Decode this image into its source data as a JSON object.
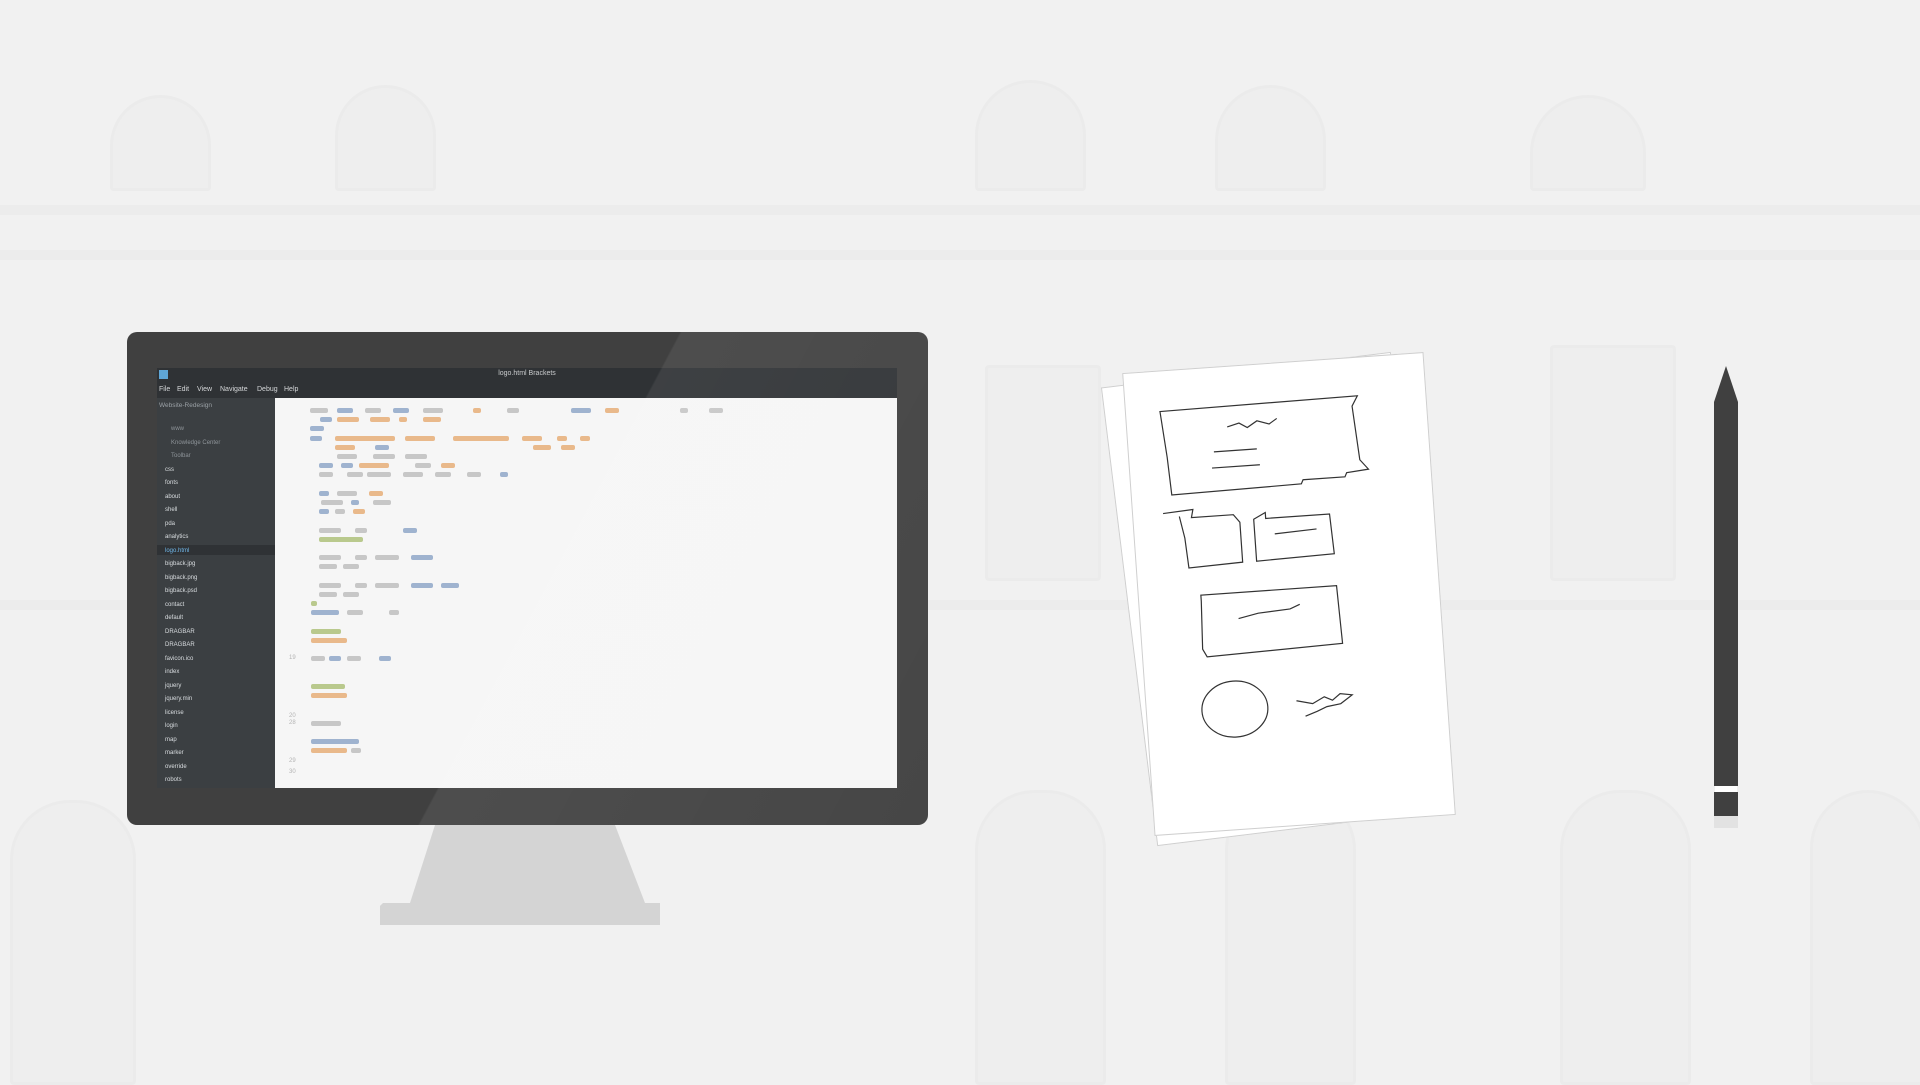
{
  "editor": {
    "window_title": "logo.html  Brackets",
    "menu": [
      "File",
      "Edit",
      "View",
      "Navigate",
      "Debug",
      "Help"
    ],
    "sidebar_header": "Website-Redesign",
    "files": [
      {
        "name": "www",
        "state": "muted"
      },
      {
        "name": "Knowledge Center",
        "state": "muted"
      },
      {
        "name": "Toolbar",
        "state": "muted"
      },
      {
        "name": "css",
        "state": "normal"
      },
      {
        "name": "fonts",
        "state": "normal"
      },
      {
        "name": "about",
        "state": "normal"
      },
      {
        "name": "shell",
        "state": "normal"
      },
      {
        "name": "pda",
        "state": "normal"
      },
      {
        "name": "analytics",
        "state": "normal"
      },
      {
        "name": "logo.html",
        "state": "active"
      },
      {
        "name": "bigback.jpg",
        "state": "normal"
      },
      {
        "name": "bigback.png",
        "state": "normal"
      },
      {
        "name": "bigback.psd",
        "state": "normal"
      },
      {
        "name": "contact",
        "state": "normal"
      },
      {
        "name": "default",
        "state": "normal"
      },
      {
        "name": "DRAGBAR",
        "state": "normal"
      },
      {
        "name": "DRAGBAR",
        "state": "normal"
      },
      {
        "name": "favicon.ico",
        "state": "normal"
      },
      {
        "name": "index",
        "state": "normal"
      },
      {
        "name": "jquery",
        "state": "normal"
      },
      {
        "name": "jquery.min",
        "state": "normal"
      },
      {
        "name": "license",
        "state": "normal"
      },
      {
        "name": "login",
        "state": "normal"
      },
      {
        "name": "map",
        "state": "normal"
      },
      {
        "name": "marker",
        "state": "normal"
      },
      {
        "name": "override",
        "state": "normal"
      },
      {
        "name": "robots",
        "state": "normal"
      },
      {
        "name": "style",
        "state": "normal"
      }
    ],
    "line_numbers": [
      "19",
      "20",
      "28",
      "29",
      "30",
      "40"
    ]
  },
  "colors": {
    "device_dark": "#404040",
    "stand": "#d4d4d4",
    "code_blue": "#9fb3cf",
    "code_orange": "#e9b98b",
    "code_green": "#b9c98d",
    "code_gray": "#c7c7c7",
    "active_file": "#6fb7ea"
  },
  "icons": [
    "app-logo-icon",
    "file-pointer-icon"
  ]
}
